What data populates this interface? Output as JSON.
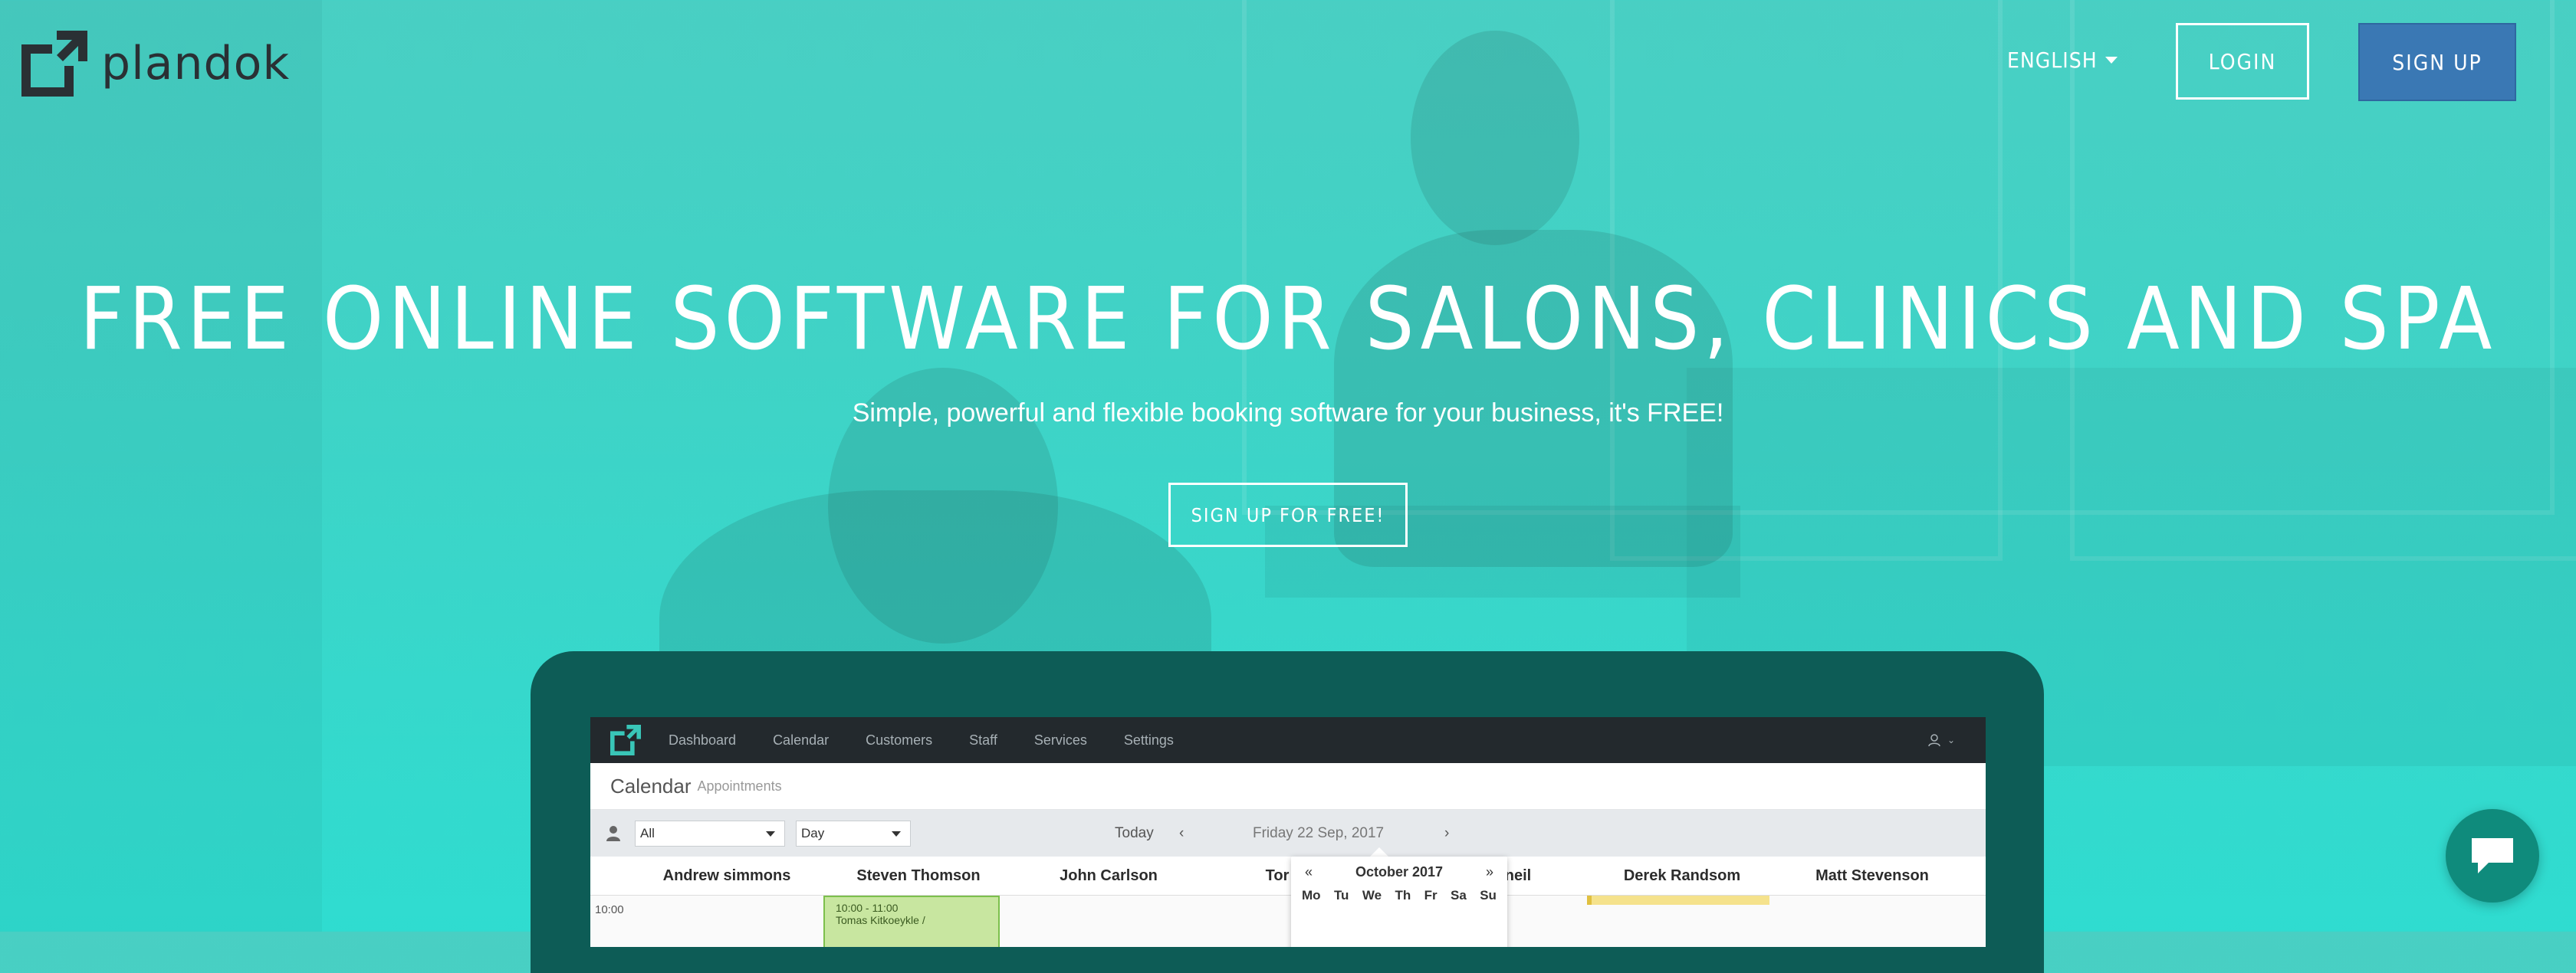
{
  "header": {
    "brand": "plandok",
    "language": "ENGLISH",
    "login_label": "LOGIN",
    "signup_label": "SIGN UP"
  },
  "hero": {
    "title": "FREE ONLINE SOFTWARE FOR SALONS, CLINICS AND SPA",
    "subtitle": "Simple, powerful and flexible booking software for your business, it's FREE!",
    "cta_label": "SIGN UP FOR FREE!"
  },
  "app_preview": {
    "nav": [
      "Dashboard",
      "Calendar",
      "Customers",
      "Staff",
      "Services",
      "Settings"
    ],
    "page_title": "Calendar",
    "page_subtitle": "Appointments",
    "staff_filter": "All",
    "view_filter": "Day",
    "today_label": "Today",
    "date_label": "Friday 22 Sep, 2017",
    "columns": [
      "Andrew simmons",
      "Steven Thomson",
      "John Carlson",
      "Tor",
      "neil",
      "Derek Randsom",
      "Matt Stevenson"
    ],
    "time": "10:00",
    "appointment_time": "10:00 - 11:00",
    "appointment_name": "Tomas Kitkoeykle /",
    "datepicker": {
      "prev": "«",
      "month": "October 2017",
      "next": "»",
      "days": [
        "Mo",
        "Tu",
        "We",
        "Th",
        "Fr",
        "Sa",
        "Su"
      ]
    }
  },
  "colors": {
    "hero_bg": "#3fd3c6",
    "signup_bg": "#3a78b4",
    "device": "#0d5c56",
    "chat": "#0f8b7c"
  },
  "icons": {
    "chat": "chat-bubble-icon",
    "user": "user-icon",
    "logo": "plandok-logo-icon"
  }
}
